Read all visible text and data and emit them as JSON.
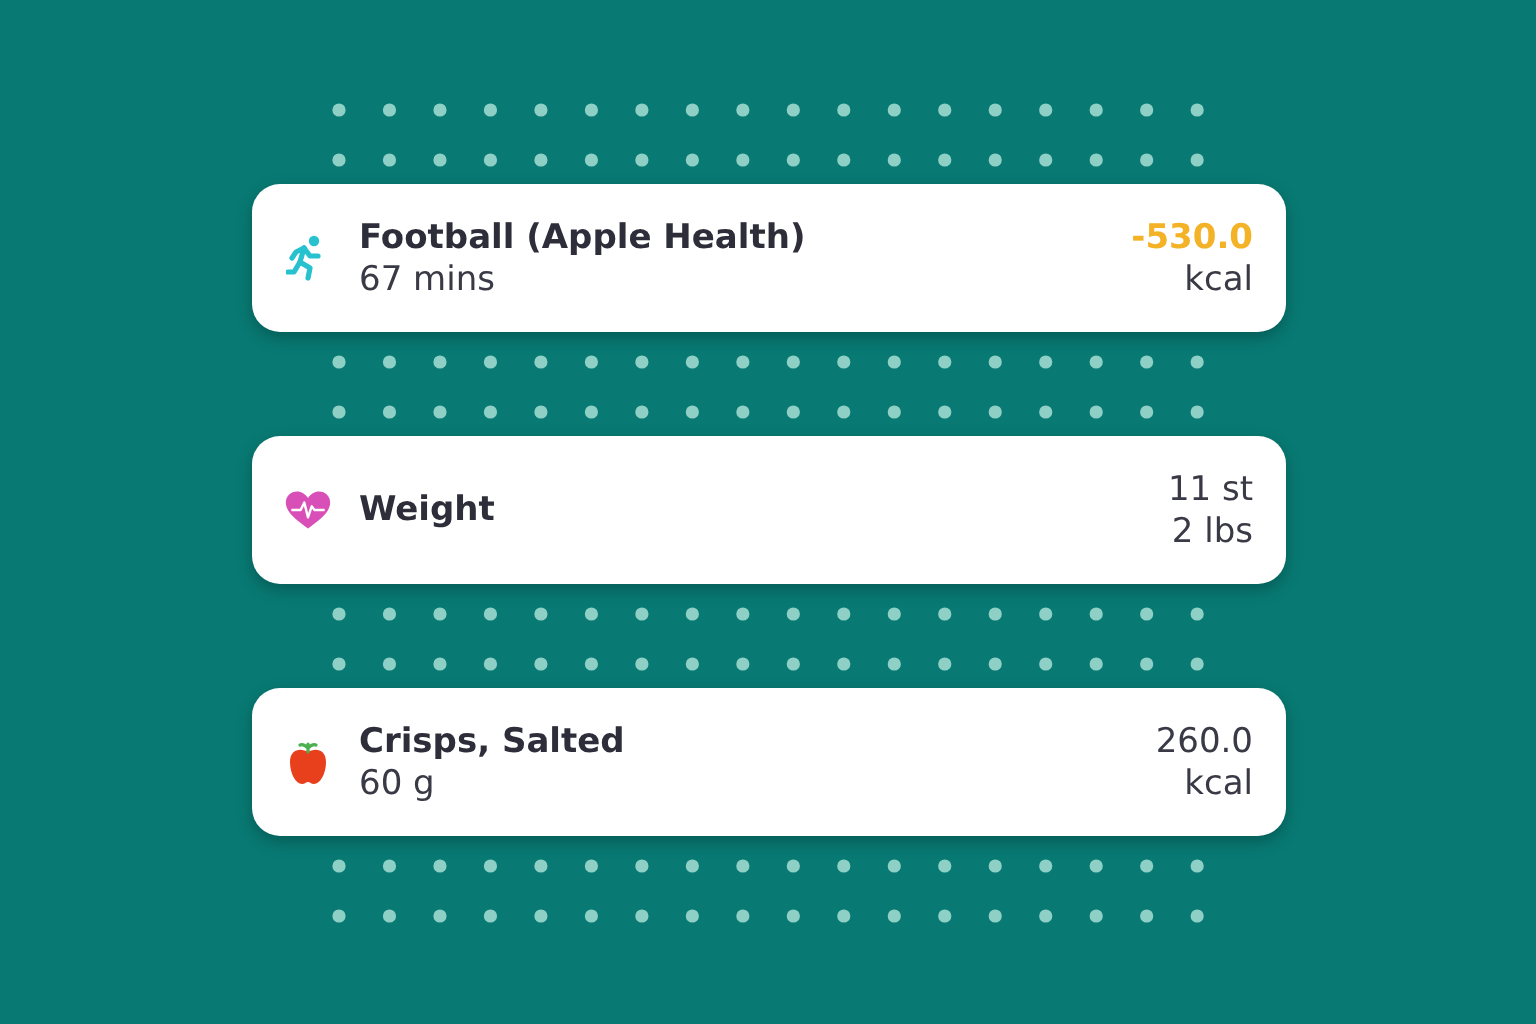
{
  "entries": [
    {
      "kind": "exercise",
      "title": "Football (Apple Health)",
      "subtitle": "67 mins",
      "value_lines": [
        "-530.0",
        "kcal"
      ]
    },
    {
      "kind": "weight",
      "title": "Weight",
      "value_lines": [
        "11 st",
        "2 lbs"
      ]
    },
    {
      "kind": "food",
      "title": "Crisps, Salted",
      "subtitle": "60 g",
      "value_lines": [
        "260.0",
        "kcal"
      ]
    }
  ]
}
